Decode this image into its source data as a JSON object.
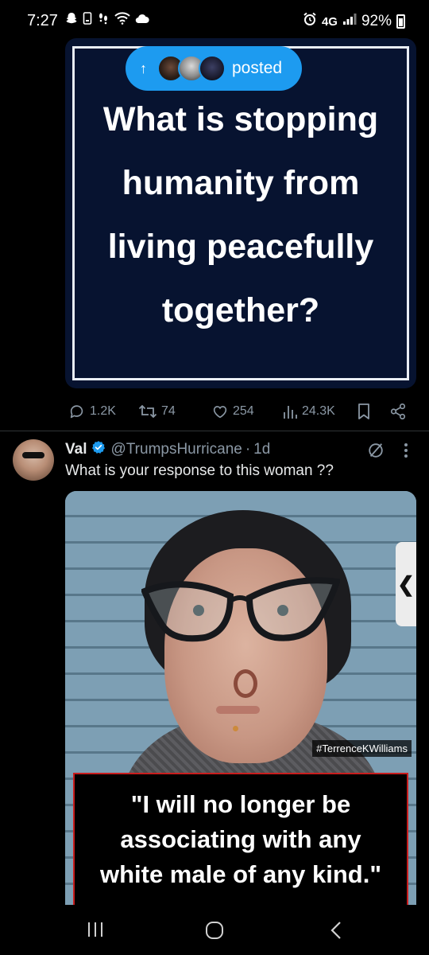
{
  "status_bar": {
    "time": "7:27",
    "network": "4G",
    "battery": "92%"
  },
  "tweet1": {
    "image_text": "What is stopping humanity from living peacefully together?",
    "posted_pill": {
      "arrow": "↑",
      "label": "posted"
    },
    "actions": {
      "replies": "1.2K",
      "reposts": "74",
      "likes": "254",
      "views": "24.3K"
    }
  },
  "tweet2": {
    "name": "Val",
    "handle": "@TrumpsHurricane",
    "separator": "·",
    "time": "1d",
    "text": "What is your response to this woman ??",
    "image": {
      "watermark": "#TerrenceKWilliams",
      "quote": "\"I will no longer be associating with any white male of any kind.\"",
      "side_tab_glyph": "❮"
    }
  },
  "colors": {
    "accent": "#1d9bf0",
    "background": "#000000",
    "muted": "#8b98a5",
    "quote_border": "#c81d1d",
    "poster_bg": "#071330"
  },
  "icons": [
    "reply-icon",
    "repost-icon",
    "like-icon",
    "views-icon",
    "bookmark-icon",
    "share-icon",
    "verified-icon",
    "grok-icon",
    "more-icon",
    "recents-icon",
    "home-icon",
    "back-icon"
  ]
}
